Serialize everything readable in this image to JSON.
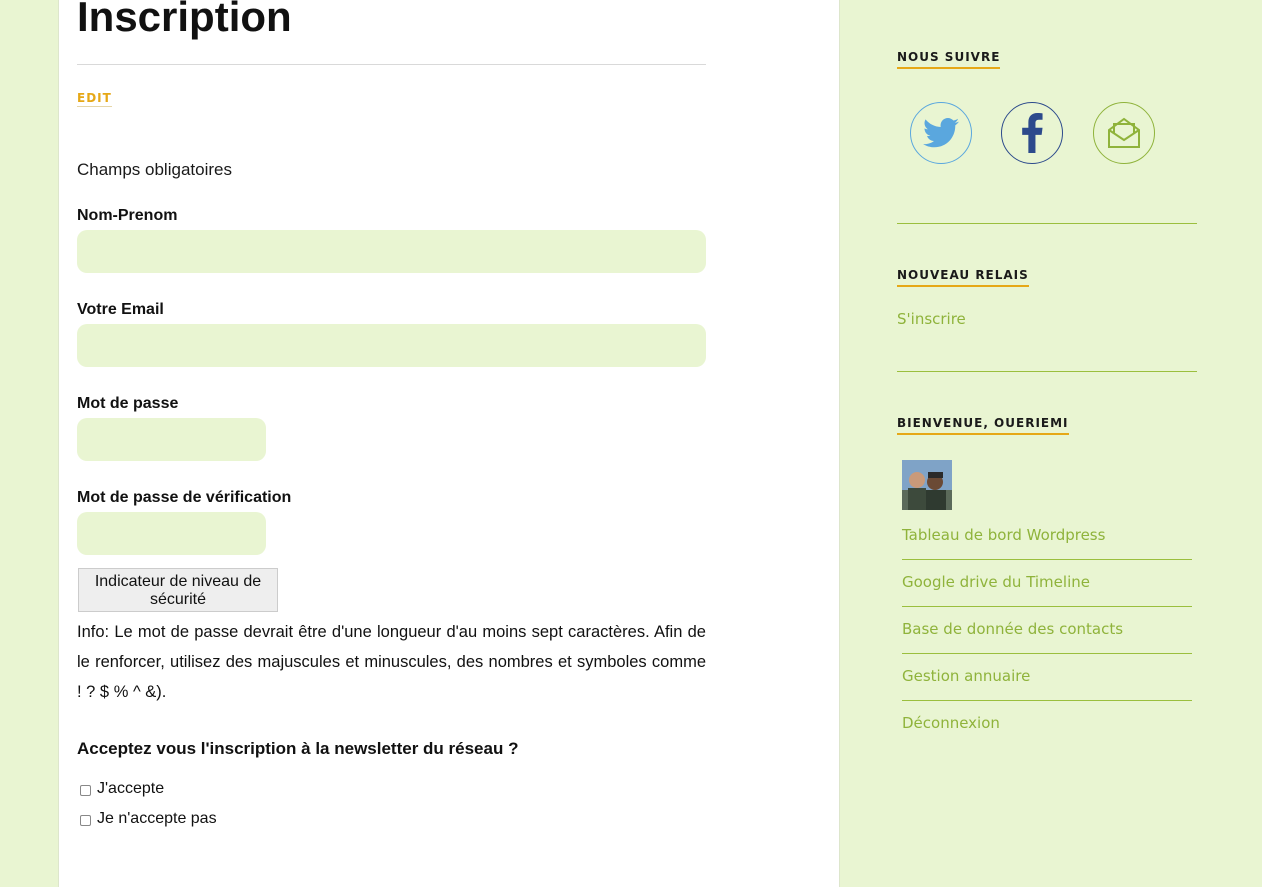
{
  "main": {
    "title": "Inscription",
    "edit_label": "EDIT",
    "required_note": "Champs obligatoires",
    "fields": {
      "name_label": "Nom-Prenom",
      "email_label": "Votre Email",
      "password_label": "Mot de passe",
      "password_confirm_label": "Mot de passe de vérification"
    },
    "strength_indicator": "Indicateur de niveau de sécurité",
    "info": "Info: Le mot de passe devrait être d'une longueur d'au moins sept caractères. Afin de le renforcer, utilisez des majuscules et minuscules, des nombres et symboles comme ! ? $ % ^ &).",
    "newsletter_question": "Acceptez vous l'inscription à la newsletter du réseau ?",
    "options": [
      "J'accepte",
      "Je n'accepte pas"
    ]
  },
  "sidebar": {
    "follow_title": "NOUS SUIVRE",
    "social": [
      {
        "name": "twitter",
        "icon": "twitter-icon",
        "color": "#5aa7de"
      },
      {
        "name": "facebook",
        "icon": "facebook-icon",
        "color": "#2c4a8c"
      },
      {
        "name": "email",
        "icon": "mail-icon",
        "color": "#8fb33b"
      }
    ],
    "relay_title": "NOUVEAU RELAIS",
    "relay_link": "S'inscrire",
    "welcome_title": "BIENVENUE, OUERIEMI",
    "menu": [
      "Tableau de bord Wordpress",
      "Google drive du Timeline",
      "Base de donnée des contacts",
      "Gestion annuaire",
      "Déconnexion"
    ]
  },
  "colors": {
    "background": "#e9f5d2",
    "accent": "#e6a817",
    "link": "#8fb33b"
  }
}
